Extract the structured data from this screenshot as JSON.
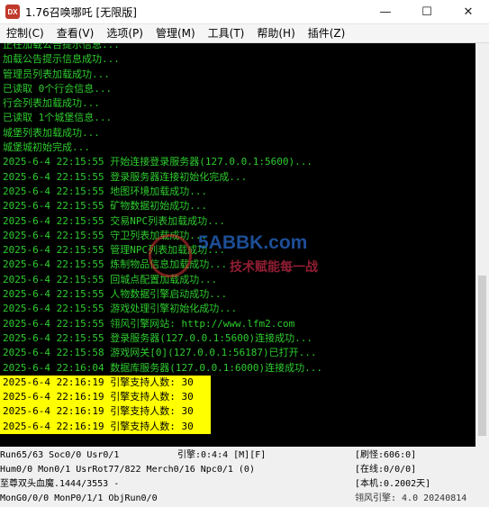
{
  "app": {
    "icon_text": "DX",
    "title": "1.76召唤哪吒 [无限版]"
  },
  "window_controls": {
    "minimize": "—",
    "maximize": "☐",
    "close": "✕"
  },
  "menu": [
    "控制(C)",
    "查看(V)",
    "选项(P)",
    "管理(M)",
    "工具(T)",
    "帮助(H)",
    "插件(Z)"
  ],
  "log": [
    "正在加载公告提示信息...",
    "加载公告提示信息成功...",
    "管理员列表加载成功...",
    "已读取 0个行会信息...",
    "行会列表加载成功...",
    "已读取 1个城堡信息...",
    "城堡列表加载成功...",
    "城堡城初始完成...",
    "2025-6-4 22:15:55 开始连接登录服务器(127.0.0.1:5600)...",
    "2025-6-4 22:15:55 登录服务器连接初始化完成...",
    "2025-6-4 22:15:55 地图环境加载成功...",
    "2025-6-4 22:15:55 矿物数据初始成功...",
    "2025-6-4 22:15:55 交易NPC列表加载成功...",
    "2025-6-4 22:15:55 守卫列表加载成功...",
    "2025-6-4 22:15:55 管理NPC列表加载成功...",
    "2025-6-4 22:15:55 炼制物品信息加载成功...",
    "2025-6-4 22:15:55 回城点配置加载成功...",
    "2025-6-4 22:15:55 人物数据引擎启动成功...",
    "2025-6-4 22:15:55 游戏处理引擎初始化成功...",
    "2025-6-4 22:15:55 翎风引擎网站: http://www.lfm2.com",
    "2025-6-4 22:15:55 登录服务器(127.0.0.1:5600)连接成功...",
    "2025-6-4 22:15:58 游戏网关[0](127.0.0.1:56187)已打开...",
    "2025-6-4 22:16:04 数据库服务器(127.0.0.1:6000)连接成功..."
  ],
  "highlighted_log": [
    "2025-6-4 22:16:19 引擎支持人数: 30",
    "2025-6-4 22:16:19 引擎支持人数: 30",
    "2025-6-4 22:16:19 引擎支持人数: 30",
    "2025-6-4 22:16:19 引擎支持人数: 30"
  ],
  "watermark": {
    "domain": "5ABBK.com",
    "slogan": "技术赋能每一战"
  },
  "status": {
    "run": "Run65/63 Soc0/0 Usr0/1",
    "engine": "引擎:0:4:4 [M][F]",
    "refresh": "[刷怪:606:0]",
    "hum": "Hum0/0 Mon0/1 UsrRot77/822 Merch0/16 Npc0/1 (0)",
    "online": "[在线:0/0/0]",
    "item": "至尊双头血魔.1444/3553 -",
    "local": "[本机:0.2002天]",
    "mon": "MonG0/0/0 MonP0/1/1 ObjRun0/0",
    "version": "翎风引擎: 4.0 20240814"
  }
}
